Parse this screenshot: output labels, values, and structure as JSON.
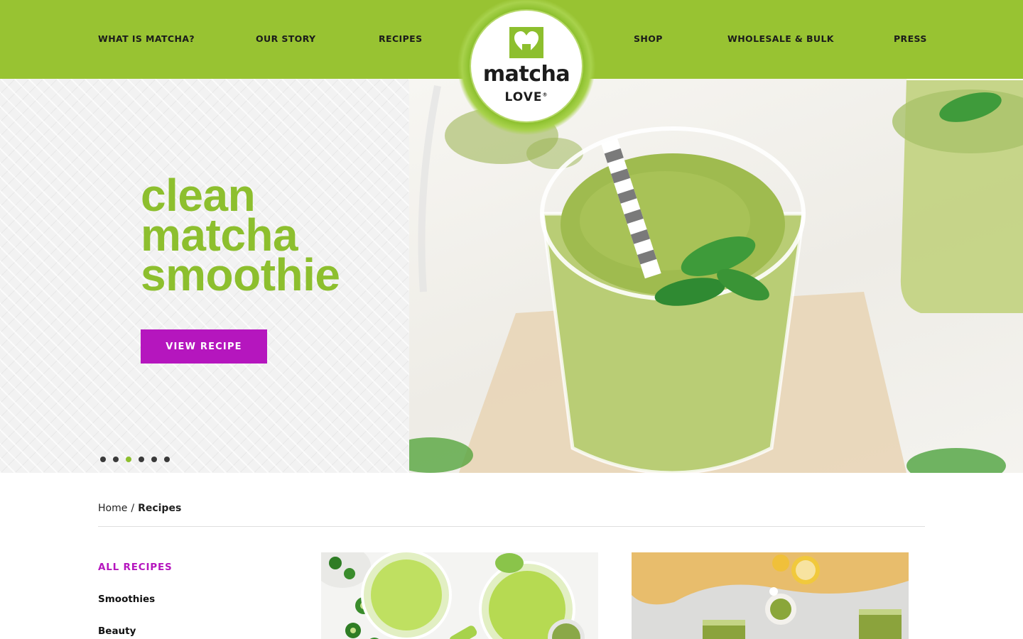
{
  "nav": {
    "left": [
      "WHAT IS MATCHA?",
      "OUR STORY",
      "RECIPES"
    ],
    "right": [
      "SHOP",
      "WHOLESALE & BULK",
      "PRESS"
    ]
  },
  "logo": {
    "word": "matcha",
    "sub": "LOVE",
    "mark": "®"
  },
  "hero": {
    "title_lines": [
      "clean",
      "matcha",
      "smoothie"
    ],
    "button_label": "VIEW RECIPE",
    "slides_count": 6,
    "active_slide_index": 2,
    "image": "matcha-smoothie-glass-with-straw-and-mint"
  },
  "breadcrumb": {
    "home": "Home",
    "separator": "/",
    "current": "Recipes"
  },
  "sidebar": {
    "items": [
      "ALL RECIPES",
      "Smoothies",
      "Beauty"
    ]
  },
  "cards": [
    {
      "image": "green-lime-drinks-with-jalapeno"
    },
    {
      "image": "matcha-squares-with-lemon"
    }
  ],
  "colors": {
    "brand_green": "#98c332",
    "headline_green": "#8dbf2e",
    "accent_magenta": "#b516be",
    "text_dark": "#1b1b1b"
  }
}
